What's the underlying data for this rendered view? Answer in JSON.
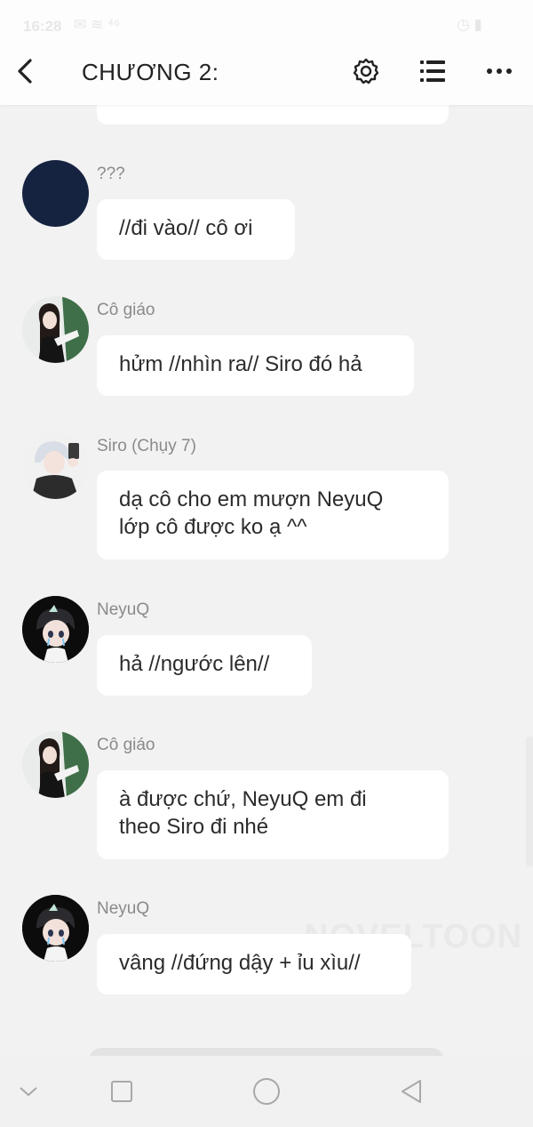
{
  "status_bar": {
    "time": "16:28",
    "icons": "✉ ≋ ⁴⁶",
    "right": "◷ ▮"
  },
  "top_bar": {
    "chapter_title": "CHƯƠNG 2:"
  },
  "messages": [
    {
      "sender": "???",
      "text": "//đi vào// cô ơi"
    },
    {
      "sender": "Cô giáo",
      "text": "hửm //nhìn ra// Siro đó hả"
    },
    {
      "sender": "Siro (Chụy 7)",
      "text_lines": [
        "dạ cô cho em mượn NeyuQ",
        "lớp cô được ko ạ ^^"
      ]
    },
    {
      "sender": "NeyuQ",
      "text": "hả //ngước lên//"
    },
    {
      "sender": "Cô giáo",
      "text_lines": [
        "à được chứ, NeyuQ em đi",
        "theo Siro đi nhé"
      ]
    },
    {
      "sender": "NeyuQ",
      "text": "vâng //đứng dậy + ỉu xìu//"
    }
  ],
  "watermark": "NOVELTOON",
  "colors": {
    "background": "#f2f2f2",
    "bubble": "#ffffff",
    "sender_name": "#8a8a8a",
    "unknown_avatar": "#162340"
  }
}
